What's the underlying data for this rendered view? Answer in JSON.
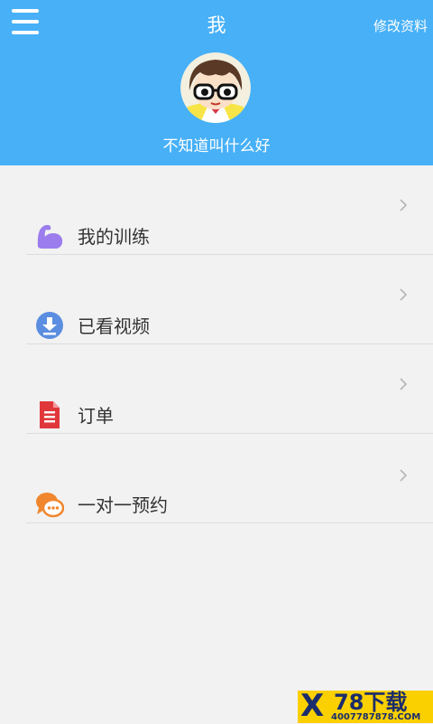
{
  "header": {
    "title": "我",
    "edit_label": "修改资料",
    "nickname": "不知道叫什么好",
    "menu_icon": "hamburger-menu-icon",
    "avatar": "cartoon-boy-with-glasses-avatar"
  },
  "menu": {
    "items": [
      {
        "label": "我的训练",
        "icon": "muscle-arm-icon",
        "icon_color": "#9b7ded"
      },
      {
        "label": "已看视频",
        "icon": "download-circle-icon",
        "icon_color": "#5b8ee0"
      },
      {
        "label": "订单",
        "icon": "document-icon",
        "icon_color": "#e0383a"
      },
      {
        "label": "一对一预约",
        "icon": "chat-bubble-icon",
        "icon_color": "#f0872e"
      }
    ],
    "chevron_icon": "chevron-right-icon"
  },
  "watermark": {
    "logo_letter": "X",
    "site_name": "78下载",
    "phone": "4007787878.COM"
  },
  "colors": {
    "header_bg": "#47b0f7",
    "page_bg": "#f2f2f2",
    "text": "#333333",
    "divider": "#dddddd"
  }
}
